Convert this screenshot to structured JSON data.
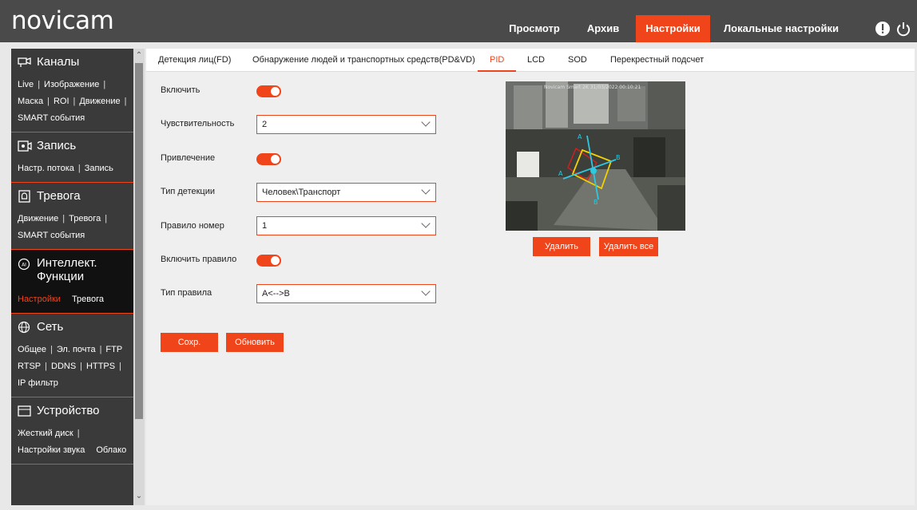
{
  "header": {
    "logo": "novicam",
    "nav": [
      "Просмотр",
      "Архив",
      "Настройки",
      "Локальные настройки"
    ],
    "active_nav": "Настройки",
    "icons": [
      "alert-icon",
      "power-icon"
    ]
  },
  "sidebar": {
    "channels": {
      "title": "Каналы",
      "row1": [
        "Live",
        "Изображение"
      ],
      "row2": [
        "Маска",
        "ROI",
        "Движение"
      ],
      "row3": [
        "SMART события"
      ]
    },
    "record": {
      "title": "Запись",
      "row1": [
        "Настр. потока",
        "Запись"
      ]
    },
    "alarm": {
      "title": "Тревога",
      "row1": [
        "Движение",
        "Тревога"
      ],
      "row2": [
        "SMART события"
      ]
    },
    "intellect": {
      "title_line1": "Интеллект.",
      "title_line2": "Функции",
      "row1": [
        "Настройки",
        "Тревога"
      ]
    },
    "network": {
      "title": "Сеть",
      "row1": [
        "Общее",
        "Эл. почта",
        "FTP"
      ],
      "row2": [
        "RTSP",
        "DDNS",
        "HTTPS"
      ],
      "row3": [
        "IP фильтр"
      ]
    },
    "device": {
      "title": "Устройство",
      "row1": [
        "Жесткий диск"
      ],
      "row2": [
        "Настройки звука",
        "Облако"
      ]
    }
  },
  "tabs": [
    "Детекция лиц(FD)",
    "Обнаружение людей и транспортных средств(PD&VD)",
    "PID",
    "LCD",
    "SOD",
    "Перекрестный подсчет"
  ],
  "active_tab": "PID",
  "form": {
    "enable_label": "Включить",
    "enable_on": true,
    "sensitivity_label": "Чувствительность",
    "sensitivity_value": "2",
    "attraction_label": "Привлечение",
    "attraction_on": true,
    "detect_type_label": "Тип детекции",
    "detect_type_value": "Человек\\Транспорт",
    "rule_number_label": "Правило номер",
    "rule_number_value": "1",
    "enable_rule_label": "Включить правило",
    "enable_rule_on": true,
    "rule_type_label": "Тип правила",
    "rule_type_value": "A<-->B"
  },
  "buttons": {
    "save": "Сохр.",
    "refresh": "Обновить",
    "delete": "Удалить",
    "delete_all": "Удалить все"
  },
  "preview": {
    "osd": "Novicam Smart 2K 31/03/2022 00:10:21",
    "line_labels": [
      "A",
      "B",
      "A",
      "B"
    ]
  },
  "colors": {
    "accent": "#f0441b",
    "header": "#4a4a4a",
    "sidebar": "#3a3a3a",
    "line": "#2ec8e0",
    "box": "#f2d100"
  }
}
